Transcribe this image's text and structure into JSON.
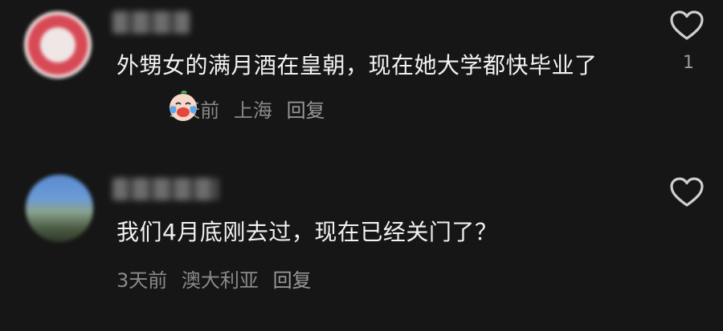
{
  "comments": [
    {
      "text": "外甥女的满月酒在皇朝，现在她大学都快毕业了",
      "emoji_icon": "crying-laughing-face-icon",
      "time": "3天前",
      "location": "上海",
      "reply_label": "回复",
      "like_count": "1"
    },
    {
      "text": "我们4月底刚去过，现在已经关门了？",
      "time": "3天前",
      "location": "澳大利亚",
      "reply_label": "回复",
      "like_count": ""
    }
  ],
  "colors": {
    "background": "#161616",
    "text": "#f2f2f2",
    "meta": "#8a8a8a"
  }
}
